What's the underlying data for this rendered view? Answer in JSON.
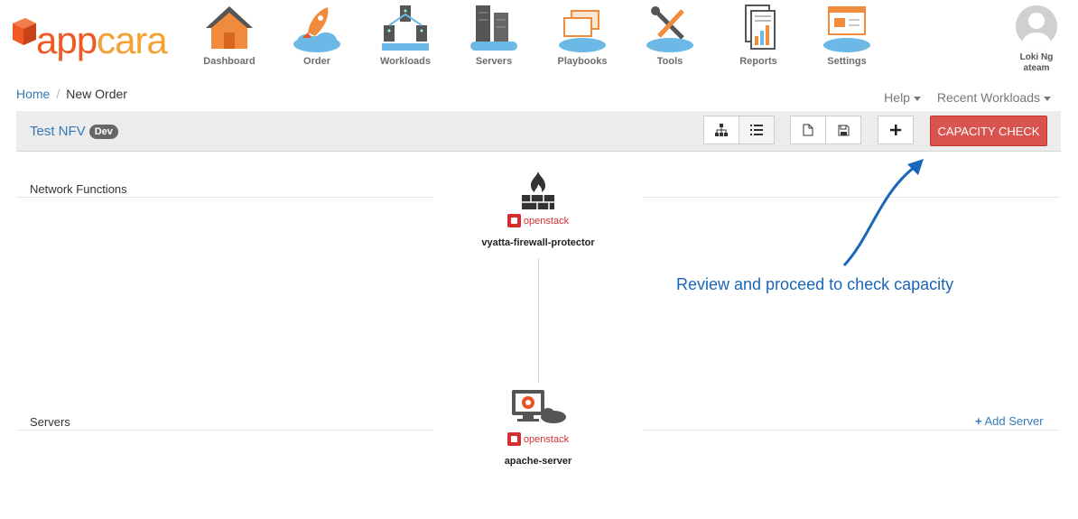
{
  "logo": {
    "part1": "app",
    "part2": "cara"
  },
  "nav": [
    {
      "label": "Dashboard",
      "icon": "house-icon"
    },
    {
      "label": "Order",
      "icon": "rocket-icon"
    },
    {
      "label": "Workloads",
      "icon": "workloads-icon"
    },
    {
      "label": "Servers",
      "icon": "servers-icon"
    },
    {
      "label": "Playbooks",
      "icon": "playbooks-icon"
    },
    {
      "label": "Tools",
      "icon": "tools-icon"
    },
    {
      "label": "Reports",
      "icon": "reports-icon"
    },
    {
      "label": "Settings",
      "icon": "settings-icon"
    }
  ],
  "user": {
    "name": "Loki Ng",
    "team": "ateam"
  },
  "breadcrumb": {
    "home": "Home",
    "current": "New Order"
  },
  "topmenu": {
    "help": "Help",
    "recent": "Recent Workloads"
  },
  "toolbar": {
    "title": "Test NFV",
    "badge": "Dev",
    "capacity": "CAPACITY CHECK"
  },
  "sections": {
    "network": "Network Functions",
    "servers": "Servers",
    "add_server": "Add Server"
  },
  "nodes": {
    "firewall": {
      "name": "vyatta-firewall-protector",
      "provider": "openstack"
    },
    "server": {
      "name": "apache-server",
      "provider": "openstack"
    }
  },
  "annotation": "Review and proceed to check capacity",
  "colors": {
    "accent": "#337ab7",
    "danger": "#d9534f",
    "brand_orange": "#ef5a24",
    "brand_yellow": "#f4a233",
    "annotation": "#1a66b8",
    "openstack": "#d32f2f"
  }
}
